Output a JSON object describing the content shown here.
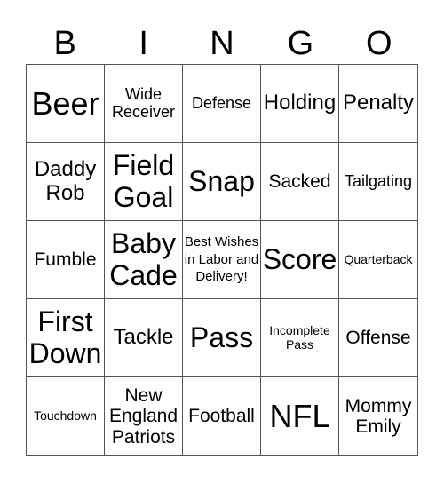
{
  "header": [
    "B",
    "I",
    "N",
    "G",
    "O"
  ],
  "cells": [
    {
      "text": "Beer",
      "size": "s-xl"
    },
    {
      "text": "Wide Receiver",
      "size": "s-s"
    },
    {
      "text": "Defense",
      "size": "s-s"
    },
    {
      "text": "Holding",
      "size": "s-m"
    },
    {
      "text": "Penalty",
      "size": "s-m"
    },
    {
      "text": "Daddy Rob",
      "size": "s-m"
    },
    {
      "text": "Field Goal",
      "size": "s-l"
    },
    {
      "text": "Snap",
      "size": "s-l"
    },
    {
      "text": "Sacked",
      "size": "s-ms"
    },
    {
      "text": "Tailgating",
      "size": "s-s"
    },
    {
      "text": "Fumble",
      "size": "s-ms"
    },
    {
      "text": "Baby Cade",
      "size": "s-l"
    },
    {
      "text": "Best Wishes in Labor and Delivery!",
      "size": "s-xs"
    },
    {
      "text": "Score",
      "size": "s-l"
    },
    {
      "text": "Quarterback",
      "size": "s-xxs"
    },
    {
      "text": "First Down",
      "size": "s-l"
    },
    {
      "text": "Tackle",
      "size": "s-m"
    },
    {
      "text": "Pass",
      "size": "s-l"
    },
    {
      "text": "Incomplete Pass",
      "size": "s-xxs"
    },
    {
      "text": "Offense",
      "size": "s-ms"
    },
    {
      "text": "Touchdown",
      "size": "s-xxs"
    },
    {
      "text": "New England Patriots",
      "size": "s-ms"
    },
    {
      "text": "Football",
      "size": "s-ms"
    },
    {
      "text": "NFL",
      "size": "s-xl"
    },
    {
      "text": "Mommy Emily",
      "size": "s-ms"
    }
  ]
}
